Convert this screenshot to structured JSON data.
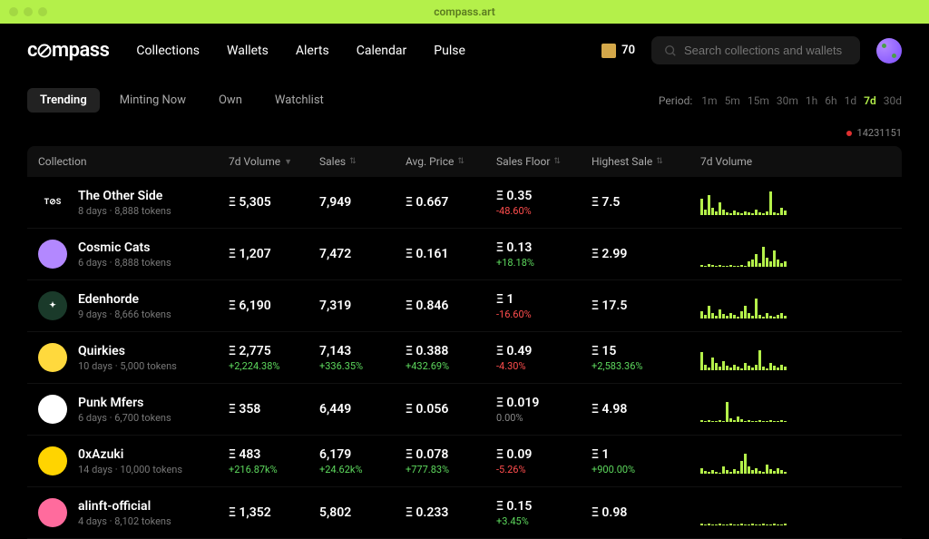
{
  "titlebar": {
    "title": "compass.art"
  },
  "logo": {
    "text_before": "c",
    "text_after": "mpass"
  },
  "nav": {
    "items": [
      "Collections",
      "Wallets",
      "Alerts",
      "Calendar",
      "Pulse"
    ]
  },
  "header": {
    "points": "70",
    "search_placeholder": "Search collections and wallets"
  },
  "tabs": {
    "items": [
      "Trending",
      "Minting Now",
      "Own",
      "Watchlist"
    ],
    "active_index": 0
  },
  "period": {
    "label": "Period:",
    "options": [
      "1m",
      "5m",
      "15m",
      "30m",
      "1h",
      "6h",
      "1d",
      "7d",
      "30d"
    ],
    "active": "7d"
  },
  "status": {
    "block": "14231151"
  },
  "columns": {
    "collection": "Collection",
    "volume": "7d Volume",
    "sales": "Sales",
    "avg": "Avg. Price",
    "floor": "Sales Floor",
    "high": "Highest Sale",
    "spark": "7d Volume"
  },
  "eth_prefix": "Ξ ",
  "rows": [
    {
      "name": "The Other Side",
      "meta": "8 days · 8,888 tokens",
      "avatar_bg": "#000",
      "avatar_text": "T⊘S",
      "volume": "5,305",
      "volume_delta": "",
      "volume_delta_sign": "",
      "sales": "7,949",
      "sales_delta": "",
      "avg": "0.667",
      "avg_delta": "",
      "floor": "0.35",
      "floor_delta": "-48.60%",
      "floor_sign": "neg",
      "high": "7.5",
      "high_delta": "",
      "spark": [
        18,
        6,
        22,
        8,
        4,
        14,
        6,
        3,
        2,
        5,
        3,
        2,
        4,
        3,
        2,
        6,
        3,
        2,
        4,
        26,
        3,
        2,
        8,
        5
      ]
    },
    {
      "name": "Cosmic Cats",
      "meta": "6 days · 8,888 tokens",
      "avatar_bg": "#b388ff",
      "avatar_text": "",
      "volume": "1,207",
      "volume_delta": "",
      "volume_delta_sign": "",
      "sales": "7,472",
      "sales_delta": "",
      "avg": "0.161",
      "avg_delta": "",
      "floor": "0.13",
      "floor_delta": "+18.18%",
      "floor_sign": "pos",
      "high": "2.99",
      "high_delta": "",
      "spark": [
        2,
        1,
        3,
        2,
        1,
        2,
        1,
        1,
        2,
        1,
        1,
        2,
        1,
        6,
        8,
        14,
        4,
        22,
        10,
        6,
        18,
        8,
        4,
        6
      ]
    },
    {
      "name": "Edenhorde",
      "meta": "9 days · 8,666 tokens",
      "avatar_bg": "#1a3a2a",
      "avatar_text": "✦",
      "volume": "6,190",
      "volume_delta": "",
      "volume_delta_sign": "",
      "sales": "7,319",
      "sales_delta": "",
      "avg": "0.846",
      "avg_delta": "",
      "floor": "1",
      "floor_delta": "-16.60%",
      "floor_sign": "neg",
      "high": "17.5",
      "high_delta": "",
      "spark": [
        8,
        4,
        14,
        6,
        3,
        10,
        5,
        3,
        6,
        4,
        2,
        8,
        14,
        6,
        3,
        22,
        4,
        2,
        6,
        3,
        2,
        4,
        6,
        3
      ]
    },
    {
      "name": "Quirkies",
      "meta": "10 days · 5,000 tokens",
      "avatar_bg": "#ffd93d",
      "avatar_text": "",
      "volume": "2,775",
      "volume_delta": "+2,224.38%",
      "volume_delta_sign": "pos",
      "sales": "7,143",
      "sales_delta": "+336.35%",
      "sales_sign": "pos",
      "avg": "0.388",
      "avg_delta": "+432.69%",
      "avg_sign": "pos",
      "floor": "0.49",
      "floor_delta": "-4.30%",
      "floor_sign": "neg",
      "high": "15",
      "high_delta": "+2,583.36%",
      "high_sign": "pos",
      "spark": [
        20,
        6,
        3,
        14,
        8,
        4,
        10,
        5,
        3,
        6,
        4,
        2,
        8,
        5,
        3,
        6,
        22,
        4,
        2,
        8,
        5,
        3,
        6,
        4
      ]
    },
    {
      "name": "Punk Mfers",
      "meta": "6 days · 6,700 tokens",
      "avatar_bg": "#fff",
      "avatar_text": "",
      "volume": "358",
      "volume_delta": "",
      "volume_delta_sign": "",
      "sales": "6,449",
      "sales_delta": "",
      "avg": "0.056",
      "avg_delta": "",
      "floor": "0.019",
      "floor_delta": "0.00%",
      "floor_sign": "neu",
      "high": "4.98",
      "high_delta": "",
      "spark": [
        2,
        1,
        2,
        1,
        1,
        2,
        1,
        22,
        4,
        2,
        6,
        3,
        1,
        2,
        1,
        1,
        2,
        1,
        1,
        2,
        1,
        1,
        2,
        1
      ]
    },
    {
      "name": "0xAzuki",
      "meta": "14 days · 10,000 tokens",
      "avatar_bg": "#ffd400",
      "avatar_text": "",
      "volume": "483",
      "volume_delta": "+216.87k%",
      "volume_delta_sign": "pos",
      "sales": "6,179",
      "sales_delta": "+24.62k%",
      "sales_sign": "pos",
      "avg": "0.078",
      "avg_delta": "+777.83%",
      "avg_sign": "pos",
      "floor": "0.09",
      "floor_delta": "-5.26%",
      "floor_sign": "neg",
      "high": "1",
      "high_delta": "+900.00%",
      "high_sign": "pos",
      "spark": [
        6,
        3,
        2,
        4,
        2,
        1,
        8,
        4,
        2,
        5,
        3,
        14,
        22,
        8,
        4,
        6,
        3,
        2,
        10,
        5,
        3,
        6,
        4,
        2
      ]
    },
    {
      "name": "alinft-official",
      "meta": "4 days · 8,102 tokens",
      "avatar_bg": "#ff6b9d",
      "avatar_text": "",
      "volume": "1,352",
      "volume_delta": "",
      "volume_delta_sign": "",
      "sales": "5,802",
      "sales_delta": "",
      "avg": "0.233",
      "avg_delta": "",
      "floor": "0.15",
      "floor_delta": "+3.45%",
      "floor_sign": "pos",
      "high": "0.98",
      "high_delta": "",
      "spark": [
        2,
        1,
        2,
        1,
        1,
        2,
        1,
        1,
        2,
        1,
        1,
        2,
        1,
        1,
        2,
        1,
        1,
        2,
        1,
        1,
        2,
        1,
        1,
        2
      ]
    }
  ]
}
